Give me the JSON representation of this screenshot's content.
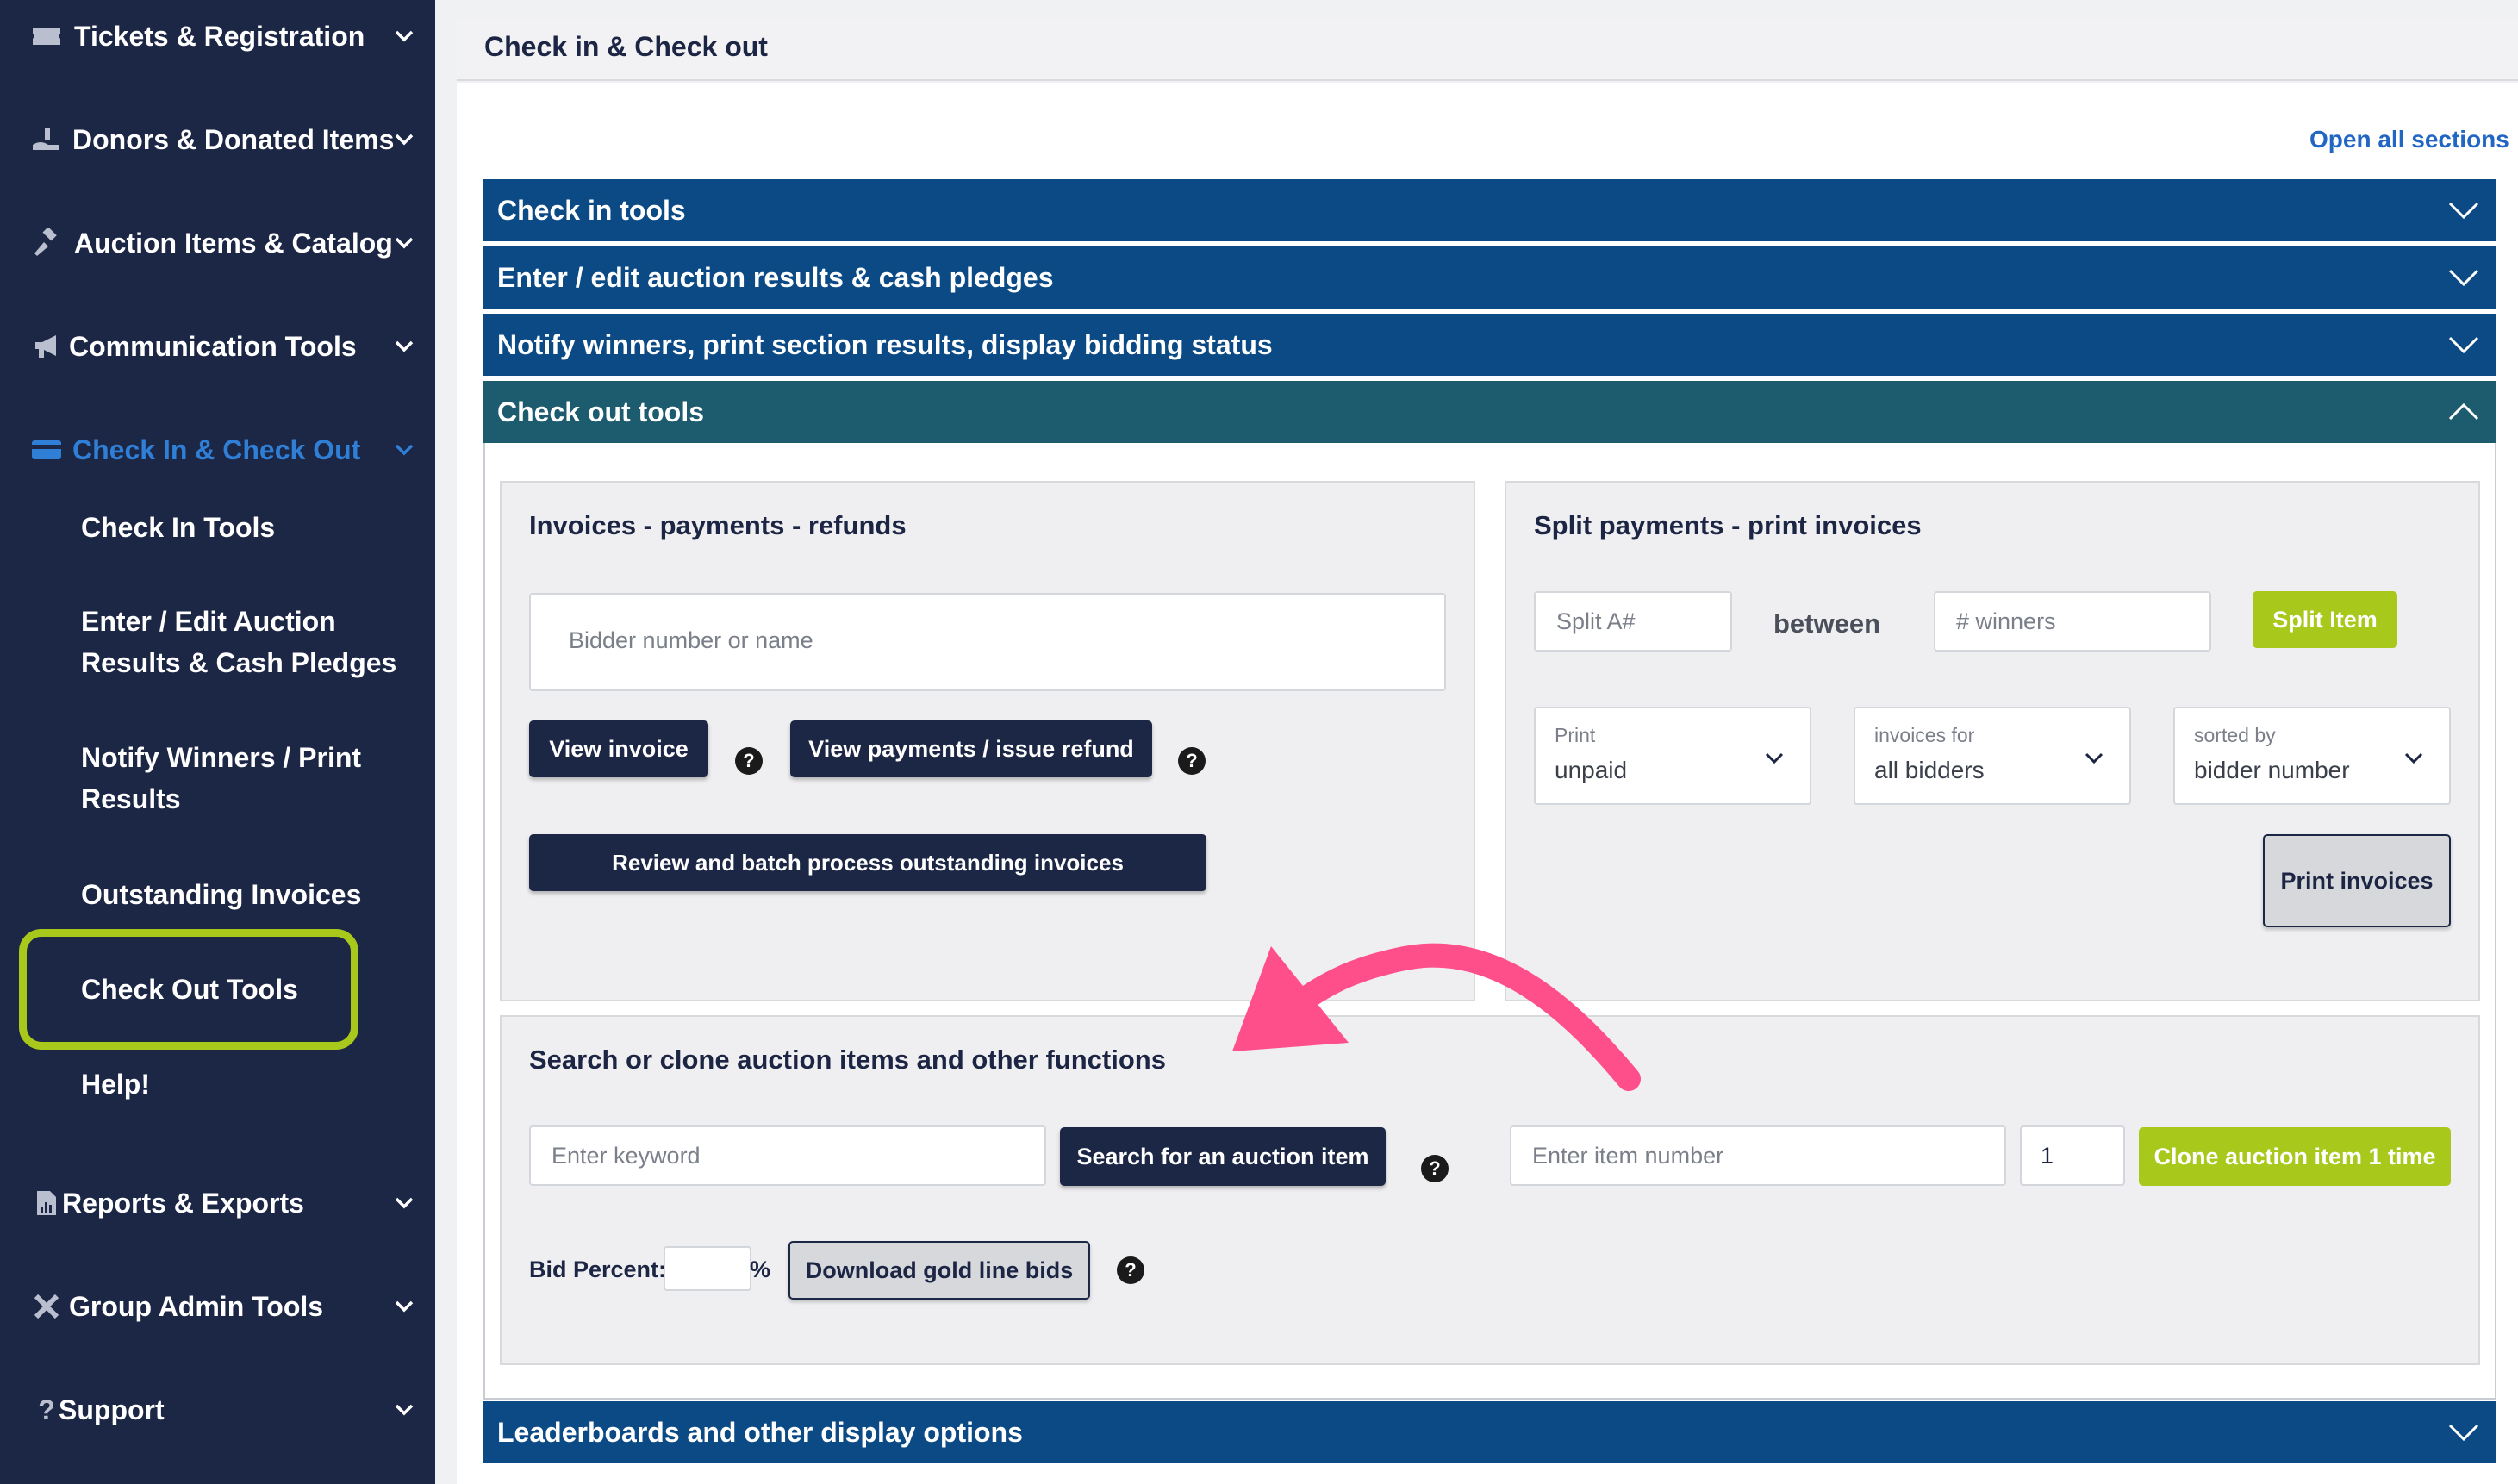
{
  "sidebar": {
    "items": [
      {
        "label": "Tickets & Registration",
        "icon": "ticket-icon"
      },
      {
        "label": "Donors & Donated Items",
        "icon": "donate-hand-icon"
      },
      {
        "label": "Auction Items & Catalog",
        "icon": "gavel-icon"
      },
      {
        "label": "Communication Tools",
        "icon": "megaphone-icon"
      },
      {
        "label": "Check In & Check Out",
        "icon": "card-icon",
        "active": true
      },
      {
        "label": "Reports & Exports",
        "icon": "file-chart-icon"
      },
      {
        "label": "Group Admin Tools",
        "icon": "tools-icon"
      },
      {
        "label": "Support",
        "icon": "question-icon"
      }
    ],
    "subitems": [
      {
        "label": "Check In Tools"
      },
      {
        "label": "Enter / Edit Auction Results & Cash Pledges"
      },
      {
        "label": "Notify Winners / Print Results"
      },
      {
        "label": "Outstanding Invoices"
      },
      {
        "label": "Check Out Tools",
        "highlighted": true
      },
      {
        "label": "Help!"
      }
    ],
    "active_color": "#2f7fd6",
    "highlight_color": "#a8c81c"
  },
  "page": {
    "title": "Check in & Check out",
    "open_all": "Open all sections"
  },
  "accordion": [
    {
      "title": "Check in tools",
      "open": false
    },
    {
      "title": "Enter / edit auction results & cash pledges",
      "open": false
    },
    {
      "title": "Notify winners, print section results, display bidding status",
      "open": false
    },
    {
      "title": "Check out tools",
      "open": true
    },
    {
      "title": "Leaderboards and other display options",
      "open": false
    }
  ],
  "invoices_panel": {
    "title": "Invoices - payments - refunds",
    "bidder_placeholder": "Bidder number or name",
    "view_invoice": "View invoice",
    "view_payments": "View payments / issue refund",
    "batch_process": "Review and batch process outstanding invoices",
    "help": "?"
  },
  "split_panel": {
    "title": "Split payments - print invoices",
    "split_placeholder": "Split A#",
    "between": "between",
    "winners_placeholder": "# winners",
    "split_button": "Split Item",
    "selects": [
      {
        "label": "Print",
        "value": "unpaid"
      },
      {
        "label": "invoices for",
        "value": "all bidders"
      },
      {
        "label": "sorted by",
        "value": "bidder number"
      }
    ],
    "print_button": "Print invoices"
  },
  "search_panel": {
    "title": "Search or clone auction items and other functions",
    "keyword_placeholder": "Enter keyword",
    "search_button": "Search for an auction item",
    "item_placeholder": "Enter item number",
    "clone_count": "1",
    "clone_button": "Clone auction item 1 time",
    "bid_percent_label": "Bid Percent:",
    "percent_sign": "%",
    "download_button": "Download gold line bids",
    "help": "?"
  },
  "colors": {
    "sidebar_bg": "#1c2645",
    "accordion_header": "#0b4a84",
    "accordion_open": "#1d5c6e",
    "accent_green": "#a8c81c",
    "link_blue": "#2266c4",
    "annotation_arrow": "#ff4f8b"
  }
}
